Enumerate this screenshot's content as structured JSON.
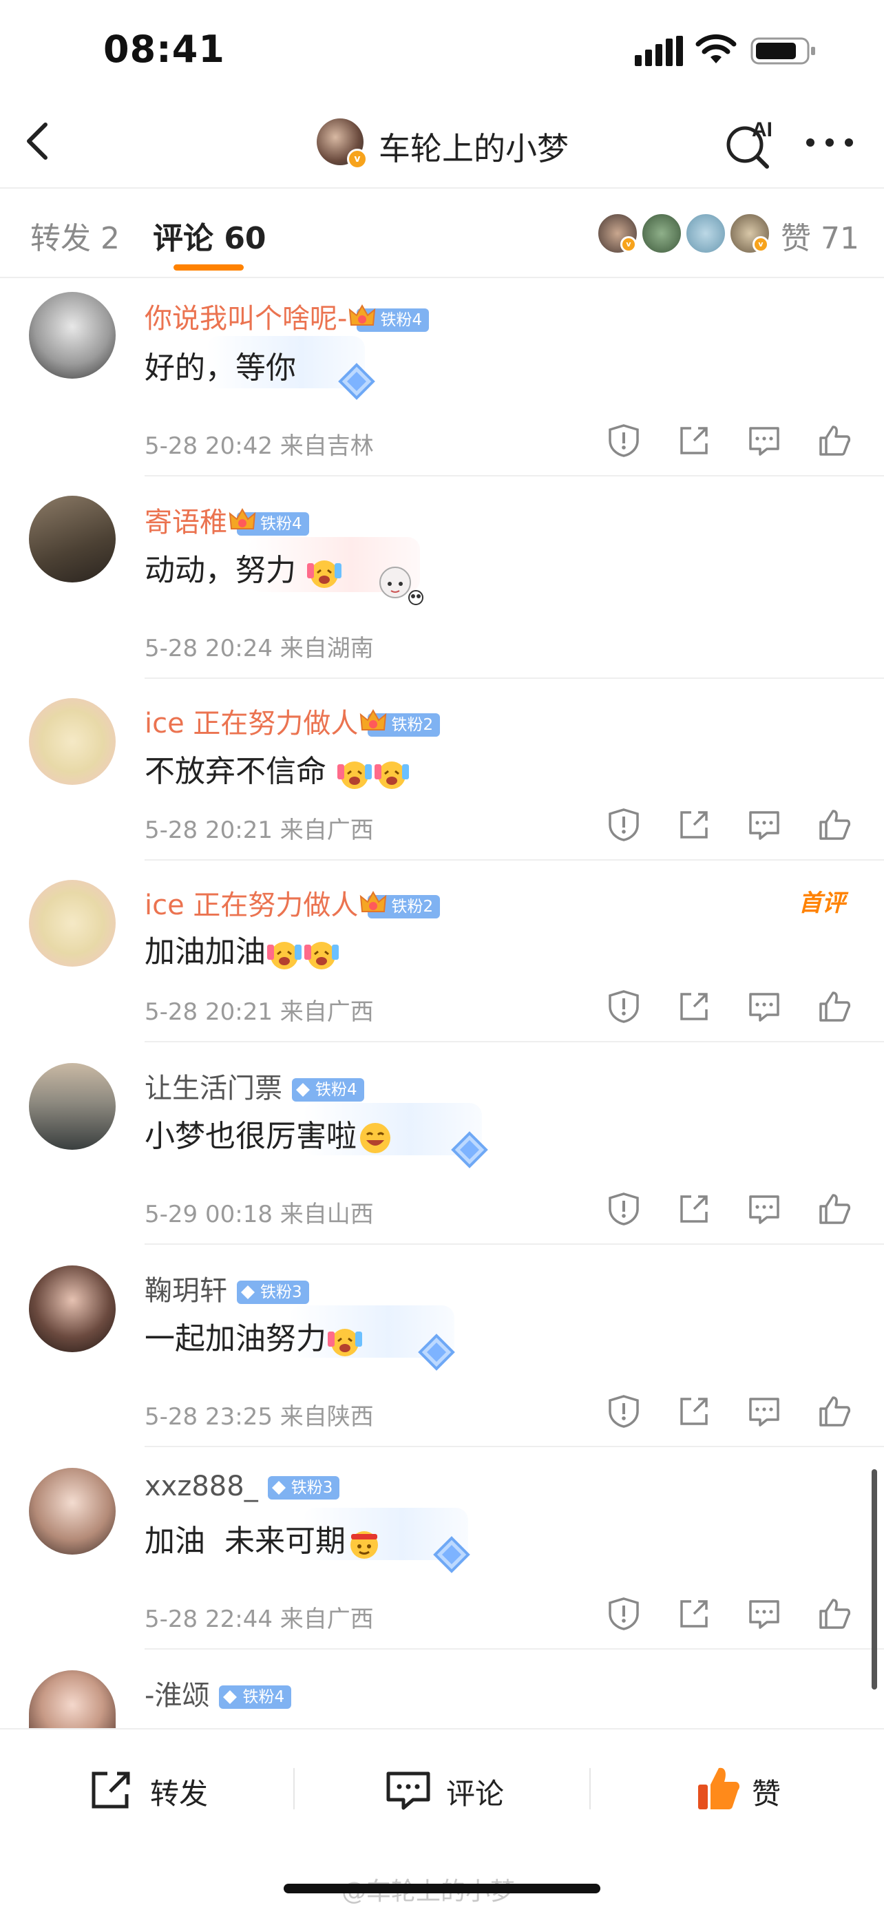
{
  "status": {
    "time": "08:41"
  },
  "header": {
    "title": "车轮上的小梦",
    "ai_label": "AI"
  },
  "tabs": {
    "repost": "转发 2",
    "comment": "评论 60",
    "like": "赞 71"
  },
  "comments": [
    {
      "name": "你说我叫个啥呢-",
      "fan": "铁粉4",
      "text": "好的，等你",
      "meta": "5-28 20:42  来自吉林"
    },
    {
      "name": "寄语稚",
      "fan": "铁粉4",
      "text": "动动，努力",
      "meta": "5-28 20:24  来自湖南"
    },
    {
      "name": "ice 正在努力做人",
      "fan": "铁粉2",
      "text": "不放弃不信命",
      "meta": "5-28 20:21  来自广西"
    },
    {
      "name": "ice 正在努力做人",
      "fan": "铁粉2",
      "text": "加油加油",
      "meta": "5-28 20:21  来自广西",
      "tag": "首评"
    },
    {
      "name": "让生活门票",
      "fan": "铁粉4",
      "text": "小梦也很厉害啦",
      "meta": "5-29 00:18  来自山西"
    },
    {
      "name": "鞠玥轩",
      "fan": "铁粉3",
      "text": "一起加油努力",
      "meta": "5-28 23:25  来自陕西"
    },
    {
      "name": "xxz888_",
      "fan": "铁粉3",
      "text": "加油  未来可期",
      "meta": "5-28 22:44  来自广西"
    },
    {
      "name": "-淮颂",
      "fan": "铁粉4"
    }
  ],
  "bottom": {
    "repost": "转发",
    "comment": "评论",
    "like": "赞"
  },
  "watermark": "@车轮上的小梦"
}
